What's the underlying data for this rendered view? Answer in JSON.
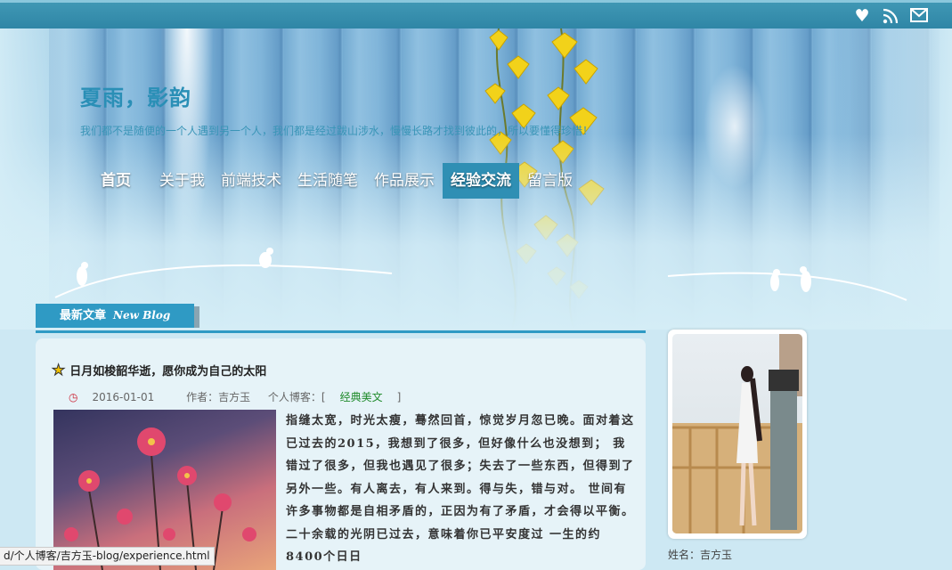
{
  "topbar": {
    "icons": [
      "heart-icon",
      "rss-icon",
      "mail-icon"
    ]
  },
  "header": {
    "title": "夏雨，影韵",
    "subtitle": "我们都不是随便的一个人遇到另一个人，我们都是经过跋山涉水，慢慢长路才找到彼此的，所以要懂得珍惜！"
  },
  "nav": {
    "items": [
      "首页",
      "关于我",
      "前端技术",
      "生活随笔",
      "作品展示",
      "经验交流",
      "留言版"
    ],
    "active": "经验交流"
  },
  "section": {
    "label": "最新文章",
    "label_en": "New Blog"
  },
  "article": {
    "title": "日月如梭韶华逝，愿你成为自己的太阳",
    "date": "2016-01-01",
    "author": "作者：吉方玉",
    "category_prefix": "个人博客：[",
    "category": "经典美文",
    "category_suffix": "]",
    "excerpt": "指缝太宽，时光太瘦，蓦然回首，惊觉岁月忽已晚。面对着这已过去的2015，我想到了很多，但好像什么也没想到； 我错过了很多，但我也遇见了很多；失去了一些东西，但得到了另外一些。有人离去，有人来到。得与失，错与对。 世间有许多事物都是自相矛盾的，正因为有了矛盾，才会得以平衡。二十余载的光阴已过去，意味着你已平安度过 一生的约8400个日日"
  },
  "profile": {
    "name": "姓名：吉方玉"
  },
  "statusbar": {
    "url": "d/个人博客/吉方玉-blog/experience.html"
  },
  "colors": {
    "topbar": "#3393b3",
    "accent": "#2f9ac4",
    "title": "#2a8fb6"
  }
}
